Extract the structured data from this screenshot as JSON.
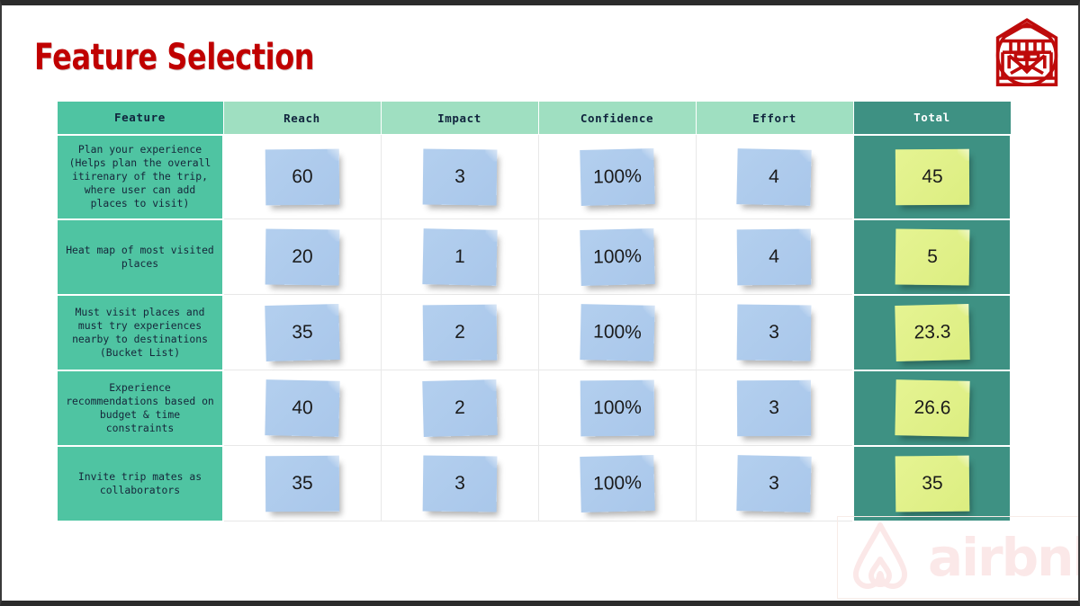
{
  "slide": {
    "title": "Feature Selection",
    "title_color": "#C00000",
    "logo_name": "lion-head-logo",
    "logo_color": "#BE0B0B"
  },
  "watermark": {
    "brand": "airbnb",
    "color": "#FBE8E8",
    "symbol_name": "airbnb-belo-icon"
  },
  "table": {
    "headers": [
      "Feature",
      "Reach",
      "Impact",
      "Confidence",
      "Effort",
      "Total"
    ],
    "header_colors": {
      "feature": "#4FC4A2",
      "metric": "#9FDFC1",
      "total": "#3E9183"
    },
    "note_colors": {
      "metric": "#ADCAEC",
      "total": "#E0F088"
    },
    "rows": [
      {
        "feature": "Plan your experience (Helps plan the overall itirenary of the trip, where user can add places to visit)",
        "reach": "60",
        "impact": "3",
        "confidence": "100%",
        "effort": "4",
        "total": "45"
      },
      {
        "feature": "Heat map of most visited places",
        "reach": "20",
        "impact": "1",
        "confidence": "100%",
        "effort": "4",
        "total": "5"
      },
      {
        "feature": "Must visit places and must try experiences nearby to destinations (Bucket List)",
        "reach": "35",
        "impact": "2",
        "confidence": "100%",
        "effort": "3",
        "total": "23.3"
      },
      {
        "feature": "Experience recommendations based on budget & time constraints",
        "reach": "40",
        "impact": "2",
        "confidence": "100%",
        "effort": "3",
        "total": "26.6"
      },
      {
        "feature": "Invite trip mates as collaborators",
        "reach": "35",
        "impact": "3",
        "confidence": "100%",
        "effort": "3",
        "total": "35"
      }
    ]
  }
}
